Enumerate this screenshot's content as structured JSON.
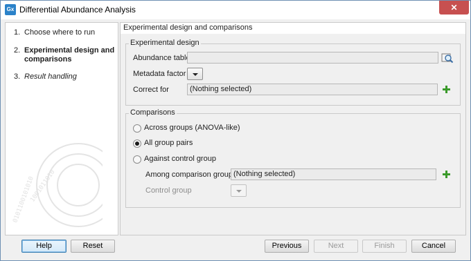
{
  "window": {
    "title": "Differential Abundance Analysis",
    "app_icon_text": "Gx",
    "close_symbol": "✕"
  },
  "steps": [
    {
      "num": "1.",
      "label": "Choose where to run",
      "state": "normal"
    },
    {
      "num": "2.",
      "label": "Experimental design and comparisons",
      "state": "active"
    },
    {
      "num": "3.",
      "label": "Result handling",
      "state": "italic"
    }
  ],
  "main": {
    "header": "Experimental design and comparisons",
    "experimental_design": {
      "legend": "Experimental design",
      "abundance_table_label": "Abundance table",
      "abundance_table_value": "",
      "metadata_factor_label": "Metadata factor",
      "correct_for_label": "Correct for",
      "correct_for_value": "(Nothing selected)"
    },
    "comparisons": {
      "legend": "Comparisons",
      "options": [
        {
          "label": "Across groups (ANOVA-like)",
          "checked": false
        },
        {
          "label": "All group pairs",
          "checked": true
        },
        {
          "label": "Against control group",
          "checked": false
        }
      ],
      "among_label": "Among comparison groups:",
      "among_value": "(Nothing selected)",
      "control_group_label": "Control group"
    }
  },
  "buttons": {
    "help": "Help",
    "reset": "Reset",
    "previous": "Previous",
    "next": "Next",
    "finish": "Finish",
    "cancel": "Cancel"
  },
  "icons": {
    "add": "plus-icon",
    "browse": "browse-icon",
    "colors": {
      "add_green": "#3a9a2a",
      "title_close": "#c75050",
      "accent": "#2b82c9"
    }
  }
}
